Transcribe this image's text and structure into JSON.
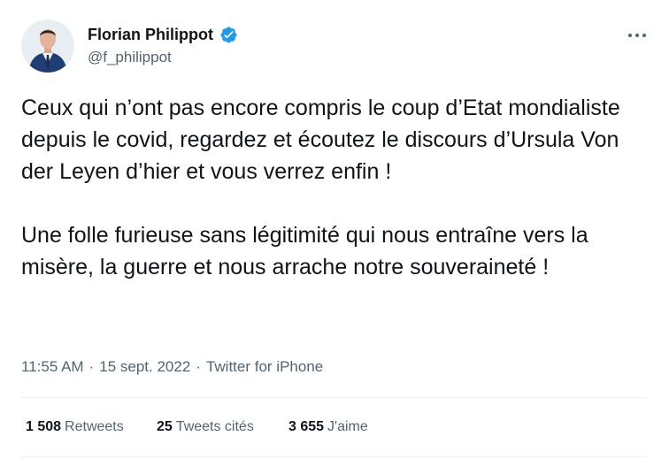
{
  "author": {
    "display_name": "Florian Philippot",
    "handle": "@f_philippot",
    "verified": true,
    "verified_color": "#1d9bf0"
  },
  "tweet": {
    "paragraphs": [
      "Ceux qui n’ont pas encore compris le coup d’Etat mondialiste depuis le covid, regardez et écoutez le discours d’Ursula Von der Leyen d’hier et vous verrez enfin !",
      "Une folle furieuse sans légitimité qui nous entraîne vers la misère, la guerre et nous arrache notre souveraineté !"
    ]
  },
  "meta": {
    "time": "11:55 AM",
    "separator": "·",
    "date": "15 sept. 2022",
    "source": "Twitter for iPhone"
  },
  "stats": {
    "retweets_count": "1 508",
    "retweets_label": "Retweets",
    "quotes_count": "25",
    "quotes_label": "Tweets cités",
    "likes_count": "3 655",
    "likes_label": "J'aime"
  },
  "icons": {
    "verified": "verified-badge-icon",
    "more": "more-options-icon"
  },
  "colors": {
    "text_primary": "#0f1419",
    "text_secondary": "#536471",
    "divider": "#eff3f4"
  }
}
